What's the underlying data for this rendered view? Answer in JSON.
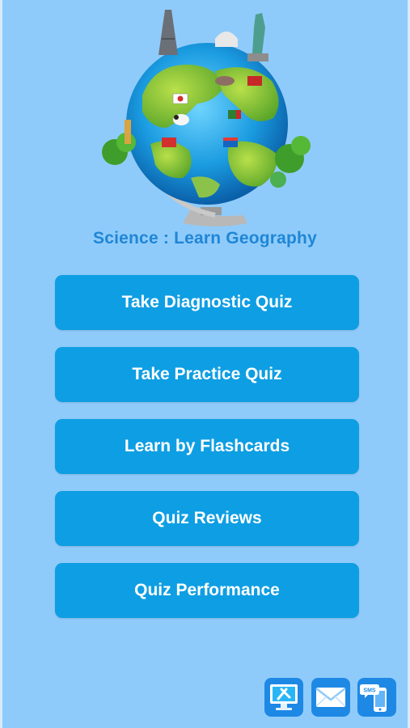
{
  "app": {
    "title": "Science : Learn Geography"
  },
  "menu": {
    "items": [
      {
        "label": "Take Diagnostic Quiz"
      },
      {
        "label": "Take Practice Quiz"
      },
      {
        "label": "Learn by Flashcards"
      },
      {
        "label": "Quiz Reviews"
      },
      {
        "label": "Quiz Performance"
      }
    ]
  },
  "dock": {
    "icons": [
      {
        "name": "tools-monitor-icon"
      },
      {
        "name": "mail-icon"
      },
      {
        "name": "sms-phone-icon",
        "text": "SMS"
      }
    ]
  },
  "colors": {
    "background": "#8fcbfa",
    "title": "#1f86d6",
    "button": "#0e9ee3",
    "button_text": "#ffffff"
  }
}
